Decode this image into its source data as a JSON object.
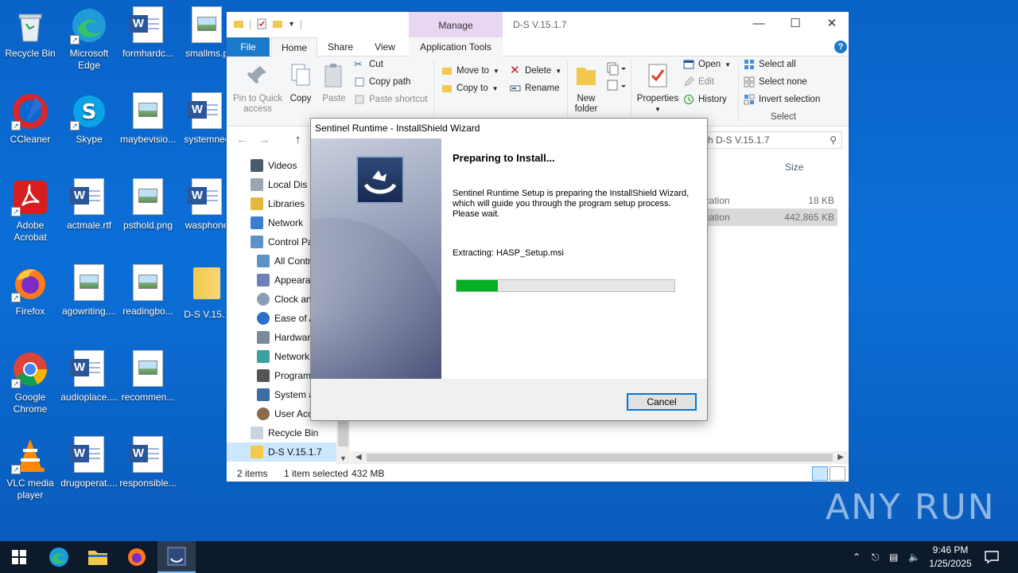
{
  "desktop": {
    "icons": [
      {
        "label": "Recycle Bin",
        "icon": "recycle-bin-icon"
      },
      {
        "label": "Microsoft Edge",
        "icon": "edge-icon"
      },
      {
        "label": "formhardc...",
        "icon": "word-doc-icon"
      },
      {
        "label": "smallms.p",
        "icon": "image-file-icon"
      },
      {
        "label": "CCleaner",
        "icon": "ccleaner-icon"
      },
      {
        "label": "Skype",
        "icon": "skype-icon"
      },
      {
        "label": "maybevisio...",
        "icon": "image-file-icon"
      },
      {
        "label": "systemnec",
        "icon": "word-doc-icon"
      },
      {
        "label": "Adobe Acrobat",
        "icon": "acrobat-icon"
      },
      {
        "label": "actmale.rtf",
        "icon": "word-doc-icon"
      },
      {
        "label": "psthold.png",
        "icon": "image-file-icon"
      },
      {
        "label": "wasphone",
        "icon": "word-doc-icon"
      },
      {
        "label": "Firefox",
        "icon": "firefox-icon"
      },
      {
        "label": "agowriting....",
        "icon": "image-file-icon"
      },
      {
        "label": "readingbo...",
        "icon": "image-file-icon"
      },
      {
        "label": "D-S V.15.1",
        "icon": "folder-icon"
      },
      {
        "label": "Google Chrome",
        "icon": "chrome-icon"
      },
      {
        "label": "audioplace....",
        "icon": "word-doc-icon"
      },
      {
        "label": "recommen...",
        "icon": "image-file-icon"
      },
      {
        "label": "VLC media player",
        "icon": "vlc-icon"
      },
      {
        "label": "drugoperat....",
        "icon": "word-doc-icon"
      },
      {
        "label": "responsible...",
        "icon": "word-doc-icon"
      }
    ]
  },
  "explorer": {
    "title": "D-S V.15.1.7",
    "manage_tab": "Manage",
    "tabs": {
      "file": "File",
      "home": "Home",
      "share": "Share",
      "view": "View",
      "app_tools": "Application Tools"
    },
    "ribbon": {
      "pin": "Pin to Quick access",
      "copy": "Copy",
      "paste": "Paste",
      "cut": "Cut",
      "copy_path": "Copy path",
      "paste_shortcut": "Paste shortcut",
      "move_to": "Move to",
      "copy_to": "Copy to",
      "delete": "Delete",
      "rename": "Rename",
      "new_folder": "New folder",
      "properties": "Properties",
      "open": "Open",
      "edit": "Edit",
      "history": "History",
      "select_all": "Select all",
      "select_none": "Select none",
      "invert_selection": "Invert selection",
      "group_select": "Select"
    },
    "search_placeholder": "h D-S V.15.1.7",
    "nav": [
      {
        "label": "Videos",
        "icon": "videos-icon"
      },
      {
        "label": "Local Dis",
        "icon": "drive-icon"
      },
      {
        "label": "Libraries",
        "icon": "libraries-icon"
      },
      {
        "label": "Network",
        "icon": "network-icon"
      },
      {
        "label": "Control Pa",
        "icon": "control-panel-icon"
      },
      {
        "label": "All Contr",
        "icon": "control-panel-icon"
      },
      {
        "label": "Appeara",
        "icon": "appearance-icon"
      },
      {
        "label": "Clock an",
        "icon": "clock-icon"
      },
      {
        "label": "Ease of A",
        "icon": "ease-of-access-icon"
      },
      {
        "label": "Hardwar",
        "icon": "hardware-icon"
      },
      {
        "label": "Network",
        "icon": "network-icon"
      },
      {
        "label": "Program",
        "icon": "programs-icon"
      },
      {
        "label": "System a",
        "icon": "system-icon"
      },
      {
        "label": "User Acc",
        "icon": "user-accounts-icon"
      },
      {
        "label": "Recycle Bin",
        "icon": "recycle-bin-icon"
      },
      {
        "label": "D-S V.15.1.7",
        "icon": "folder-icon"
      }
    ],
    "columns": {
      "size": "Size"
    },
    "files": [
      {
        "type": "ication",
        "size": "18 KB"
      },
      {
        "type": "ication",
        "size": "442,865 KB"
      }
    ],
    "status": {
      "items": "2 items",
      "selected": "1 item selected",
      "size": "432 MB"
    }
  },
  "dialog": {
    "title": "Sentinel Runtime - InstallShield Wizard",
    "heading": "Preparing to Install...",
    "description": "Sentinel Runtime Setup is preparing the InstallShield Wizard, which will guide you through the program setup process. Please wait.",
    "extracting": "Extracting: HASP_Setup.msi",
    "progress": 0.19,
    "cancel": "Cancel"
  },
  "watermark": "ANY RUN",
  "taskbar": {
    "time": "9:46 PM",
    "date": "1/25/2025",
    "apps": [
      "start-icon",
      "edge-icon",
      "file-explorer-icon",
      "firefox-icon",
      "installshield-icon"
    ]
  },
  "colors": {
    "accent": "#1979ca",
    "progress": "#06b025",
    "desktop": "#0b6fd8",
    "manage": "#e9d6f2"
  }
}
